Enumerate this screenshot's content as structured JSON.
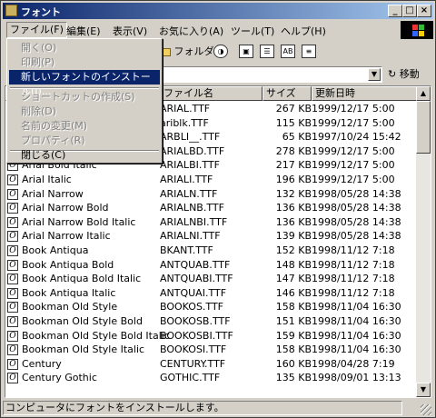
{
  "window": {
    "title": "フォント"
  },
  "menubar": [
    {
      "label": "ファイル(F)"
    },
    {
      "label": "編集(E)"
    },
    {
      "label": "表示(V)"
    },
    {
      "label": "お気に入り(A)"
    },
    {
      "label": "ツール(T)"
    },
    {
      "label": "ヘルプ(H)"
    }
  ],
  "file_menu": {
    "items": [
      {
        "label": "開く(O)",
        "state": "disabled"
      },
      {
        "label": "印刷(P)",
        "state": "disabled"
      },
      {
        "label": "新しいフォントのインストール(I)...",
        "state": "selected"
      },
      {
        "label": "ショートカットの作成(S)",
        "state": "disabled"
      },
      {
        "label": "削除(D)",
        "state": "disabled"
      },
      {
        "label": "名前の変更(M)",
        "state": "disabled"
      },
      {
        "label": "プロパティ(R)",
        "state": "disabled"
      },
      {
        "label": "閉じる(C)",
        "state": "enabled"
      }
    ]
  },
  "toolbar": {
    "folder_label": "フォルダ",
    "view_icons": [
      "大きいアイコン",
      "一覧",
      "AB",
      "詳細"
    ]
  },
  "address": {
    "value": "",
    "go_label": "移動"
  },
  "columns": {
    "name": "",
    "file": "ファイル名",
    "size": "サイズ",
    "date": "更新日時"
  },
  "rows": [
    {
      "name": "",
      "file": "ARIAL.TTF",
      "size": "267 KB",
      "date": "1999/12/17 5:00"
    },
    {
      "name": "",
      "file": "ariblk.TTF",
      "size": "115 KB",
      "date": "1999/12/17 5:00"
    },
    {
      "name": "",
      "file": "ARBLI__.TTF",
      "size": "65 KB",
      "date": "1997/10/24 15:42"
    },
    {
      "name": "",
      "file": "ARIALBD.TTF",
      "size": "278 KB",
      "date": "1999/12/17 5:00"
    },
    {
      "name": "Arial Bold Italic",
      "file": "ARIALBI.TTF",
      "size": "217 KB",
      "date": "1999/12/17 5:00"
    },
    {
      "name": "Arial Italic",
      "file": "ARIALI.TTF",
      "size": "196 KB",
      "date": "1999/12/17 5:00"
    },
    {
      "name": "Arial Narrow",
      "file": "ARIALN.TTF",
      "size": "132 KB",
      "date": "1998/05/28 14:38"
    },
    {
      "name": "Arial Narrow Bold",
      "file": "ARIALNB.TTF",
      "size": "136 KB",
      "date": "1998/05/28 14:38"
    },
    {
      "name": "Arial Narrow Bold Italic",
      "file": "ARIALNBI.TTF",
      "size": "136 KB",
      "date": "1998/05/28 14:38"
    },
    {
      "name": "Arial Narrow Italic",
      "file": "ARIALNI.TTF",
      "size": "139 KB",
      "date": "1998/05/28 14:38"
    },
    {
      "name": "Book Antiqua",
      "file": "BKANT.TTF",
      "size": "152 KB",
      "date": "1998/11/12 7:18"
    },
    {
      "name": "Book Antiqua Bold",
      "file": "ANTQUAB.TTF",
      "size": "148 KB",
      "date": "1998/11/12 7:18"
    },
    {
      "name": "Book Antiqua Bold Italic",
      "file": "ANTQUABI.TTF",
      "size": "147 KB",
      "date": "1998/11/12 7:18"
    },
    {
      "name": "Book Antiqua Italic",
      "file": "ANTQUAI.TTF",
      "size": "146 KB",
      "date": "1998/11/12 7:18"
    },
    {
      "name": "Bookman Old Style",
      "file": "BOOKOS.TTF",
      "size": "158 KB",
      "date": "1998/11/04 16:30"
    },
    {
      "name": "Bookman Old Style Bold",
      "file": "BOOKOSB.TTF",
      "size": "151 KB",
      "date": "1998/11/04 16:30"
    },
    {
      "name": "Bookman Old Style Bold Italic",
      "file": "BOOKOSBI.TTF",
      "size": "159 KB",
      "date": "1998/11/04 16:30"
    },
    {
      "name": "Bookman Old Style Italic",
      "file": "BOOKOSI.TTF",
      "size": "158 KB",
      "date": "1998/11/04 16:30"
    },
    {
      "name": "Century",
      "file": "CENTURY.TTF",
      "size": "160 KB",
      "date": "1998/04/28 7:19"
    },
    {
      "name": "Century Gothic",
      "file": "GOTHIC.TTF",
      "size": "135 KB",
      "date": "1998/09/01 13:13"
    }
  ],
  "status": {
    "text": "コンピュータにフォントをインストールします。"
  },
  "colors": {
    "titlebar_start": "#0a246a",
    "titlebar_end": "#a6caf0",
    "selection": "#0a246a",
    "face": "#d4d0c8"
  }
}
